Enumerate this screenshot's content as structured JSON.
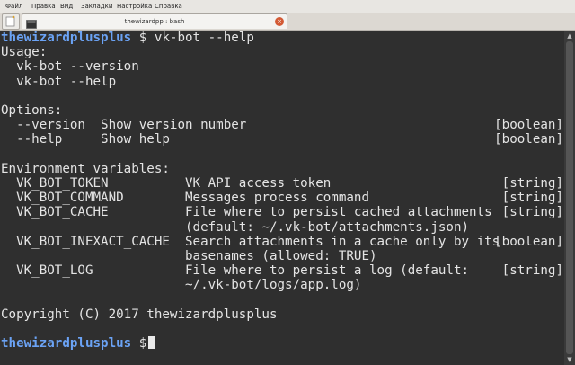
{
  "menu": {
    "file": "Файл",
    "edit": "Правка",
    "view": "Вид",
    "bookmarks": "Закладки",
    "settings": "Настройка",
    "help": "Справка"
  },
  "tab": {
    "title": "thewizardpp : bash",
    "close": "×"
  },
  "terminal": {
    "user": "thewizardplusplus",
    "prompt_sym": "$",
    "command": " vk-bot --help",
    "lines": [
      "Usage:",
      "  vk-bot --version",
      "  vk-bot --help",
      "",
      "Options:",
      "  --version  Show version number",
      "  --help     Show help",
      "",
      "Environment variables:",
      "  VK_BOT_TOKEN          VK API access token",
      "  VK_BOT_COMMAND        Messages process command",
      "  VK_BOT_CACHE          File where to persist cached attachments",
      "                        (default: ~/.vk-bot/attachments.json)",
      "  VK_BOT_INEXACT_CACHE  Search attachments in a cache only by its",
      "                        basenames (allowed: TRUE)",
      "  VK_BOT_LOG            File where to persist a log (default:",
      "                        ~/.vk-bot/logs/app.log)",
      "",
      "Copyright (C) 2017 thewizardplusplus"
    ],
    "types": {
      "version": "[boolean]",
      "help": "[boolean]",
      "token": "[string]",
      "command": "[string]",
      "cache": "[string]",
      "inexact_cache": "[boolean]",
      "log": "[string]"
    }
  },
  "icons": {
    "new_tab": "new-tab-icon",
    "terminal": "terminal-icon",
    "close": "close-icon"
  }
}
